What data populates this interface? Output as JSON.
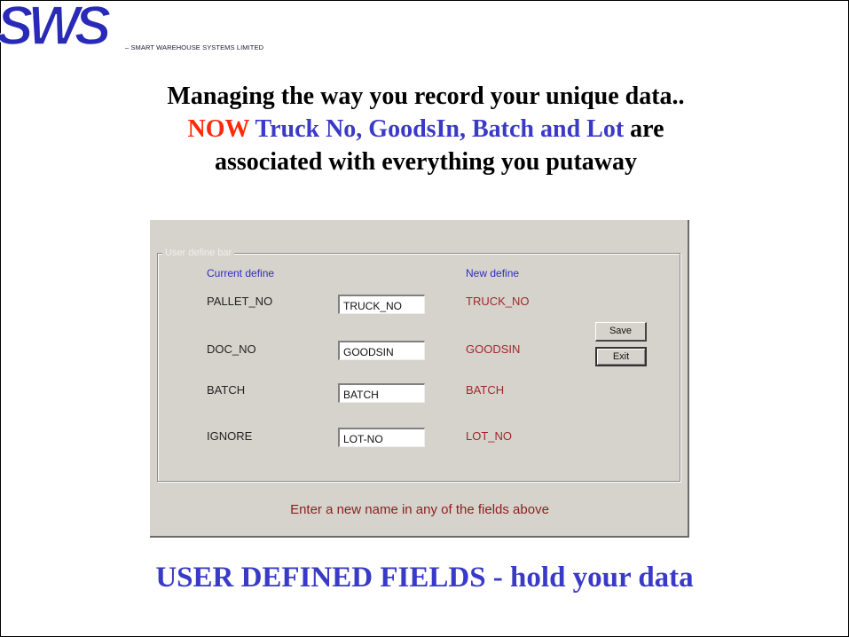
{
  "brand": {
    "logo_text": "SWS",
    "company_name": "– SMART WAREHOUSE SYSTEMS LIMITED"
  },
  "headline": {
    "part1": "Managing the way you record your unique data..",
    "now": "NOW",
    "fields": "Truck No, GoodsIn, Batch and Lot",
    "part2": "are associated with everything you putaway"
  },
  "dialog": {
    "group_title": "User define bar",
    "current_header": "Current define",
    "new_header": "New define",
    "rows": [
      {
        "current": "PALLET_NO",
        "input": "TRUCK_NO",
        "new": "TRUCK_NO"
      },
      {
        "current": "DOC_NO",
        "input": "GOODSIN",
        "new": "GOODSIN"
      },
      {
        "current": "BATCH",
        "input": "BATCH",
        "new": "BATCH"
      },
      {
        "current": "IGNORE",
        "input": "LOT-NO",
        "new": "LOT_NO"
      }
    ],
    "save_label": "Save",
    "exit_label": "Exit",
    "message": "Enter a new name in any of the fields above"
  },
  "footer": "USER DEFINED FIELDS - hold your data",
  "colors": {
    "logo_blue": "#2a2ab8",
    "headline_red": "#ff2a0a",
    "headline_blue": "#3a3ac8",
    "dialog_bg": "#d6d3cc",
    "new_value_red": "#a0282a"
  }
}
